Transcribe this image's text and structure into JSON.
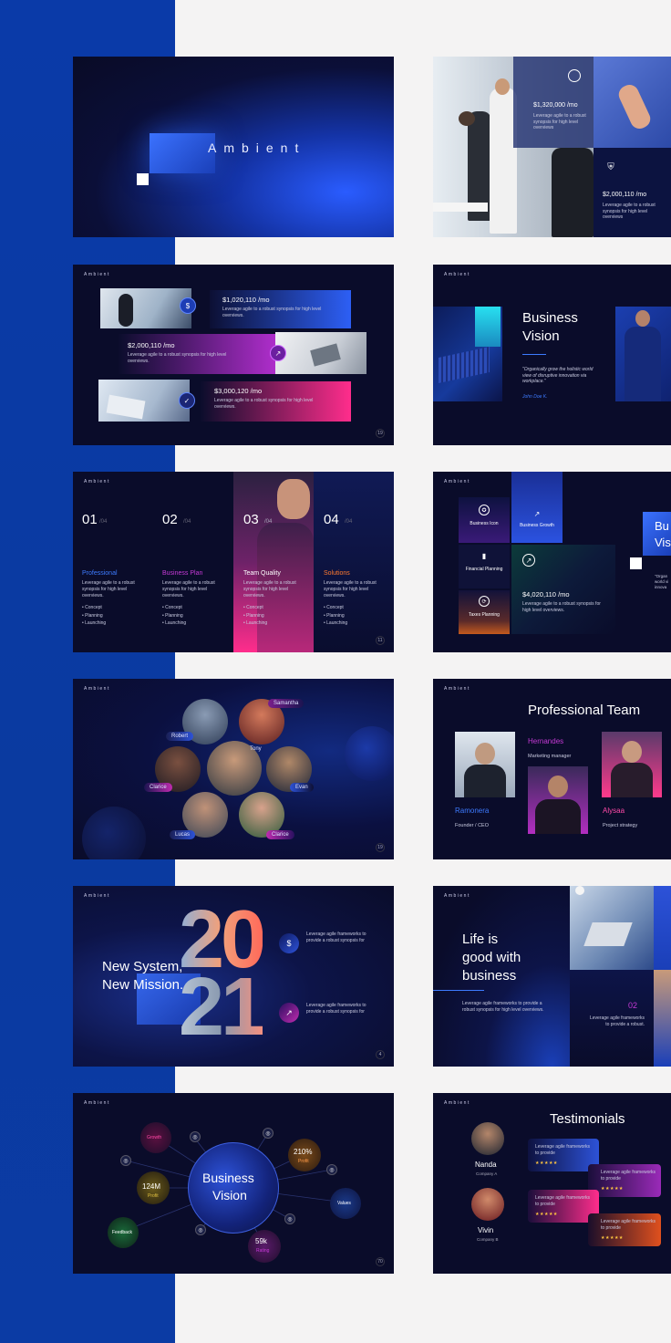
{
  "s1": {
    "title": "Ambient"
  },
  "s2": {
    "stat1": {
      "value": "$1,320,000 /mo",
      "text": "Leverage agile to a robust synopsis for high level overviews"
    },
    "stat2": {
      "value": "$2,000,110 /mo",
      "text": "Leverage agile to a robust synopsis for high level overviews"
    }
  },
  "s3": {
    "brand": "Ambient",
    "items": [
      {
        "value": "$1,020,110 /mo",
        "text": "Leverage agile to a robust synopsis for high level overviews."
      },
      {
        "value": "$2,000,110 /mo",
        "text": "Leverage agile to a robust synopsis for high level overviews."
      },
      {
        "value": "$3,000,120 /mo",
        "text": "Leverage agile to a robust synopsis for high level overviews."
      }
    ],
    "page": "19"
  },
  "s4": {
    "brand": "Ambient",
    "title1": "Business",
    "title2": "Vision",
    "quote": "\"Organically grow the holistic world view of disruptive innovation via workplace.\"",
    "author": "John Doe K."
  },
  "s5": {
    "brand": "Ambient",
    "cols": [
      {
        "num": "01",
        "total": "/04",
        "title": "Professional",
        "text": "Leverage agile to a robust synopsis for high level overviews.",
        "bullets": [
          "Concept",
          "Planning",
          "Launching"
        ],
        "color": "#3d7bff"
      },
      {
        "num": "02",
        "total": "/04",
        "title": "Business Plan",
        "text": "Leverage agile to a robust synopsis for high level overviews.",
        "bullets": [
          "Concept",
          "Planning",
          "Launching"
        ],
        "color": "#c63ad6"
      },
      {
        "num": "03",
        "total": "/04",
        "title": "Team Quality",
        "text": "Leverage agile to a robust synopsis for high level overviews.",
        "bullets": [
          "Concept",
          "Planning",
          "Launching"
        ],
        "color": "#ffffff"
      },
      {
        "num": "04",
        "total": "/04",
        "title": "Solutions",
        "text": "Leverage agile to a robust synopsis for high level overviews.",
        "bullets": [
          "Concept",
          "Planning",
          "Launching"
        ],
        "color": "#ff7a2e"
      }
    ],
    "page": "11"
  },
  "s6": {
    "brand": "Ambient",
    "tiles": [
      {
        "label": "Business Icon",
        "icon": "award-icon"
      },
      {
        "label": "Business Growth",
        "icon": "chart-icon"
      },
      {
        "label": "Financial Planning",
        "icon": "bar-chart-icon"
      },
      {
        "label": "Taxes Planning",
        "icon": "refresh-icon"
      }
    ],
    "stat": {
      "value": "$4,020,110 /mo",
      "text": "Leverage agile to a robust synopsis for high level overviews."
    },
    "side_title1": "Bu",
    "side_title2": "Vis",
    "side_text": "\"Organ world vi innova"
  },
  "s7": {
    "brand": "Ambient",
    "people": [
      "Samantha",
      "Robert",
      "Tony",
      "Clarice",
      "Evan",
      "Lucas",
      "Clarice"
    ],
    "page": "19"
  },
  "s8": {
    "brand": "Ambient",
    "title": "Professional Team",
    "members": [
      {
        "name": "Hernandes",
        "role": "Marketing manager",
        "color": "#c63ad6"
      },
      {
        "name": "Ramonera",
        "role": "Founder / CEO",
        "color": "#3d7bff"
      },
      {
        "name": "Alysaa",
        "role": "Project strategy",
        "color": "#ff4aa8"
      }
    ]
  },
  "s9": {
    "brand": "Ambient",
    "line1": "New System,",
    "line2": "New Mission.",
    "year1": "20",
    "year2": "21",
    "item1": "Leverage agile frameworks to provide a robust synopsis for",
    "item2": "Leverage agile frameworks to provide a robust synopsis for",
    "page": "4"
  },
  "s10": {
    "brand": "Ambient",
    "line1": "Life is",
    "line2": "good with",
    "line3": "business",
    "text": "Leverage agile frameworks to provide a robust synopsis for high level overviews.",
    "num": "02",
    "num_text": "Leverage agile frameworks to provide a robust."
  },
  "s11": {
    "brand": "Ambient",
    "center1": "Business",
    "center2": "Vision",
    "nodes": [
      {
        "label": "Growth"
      },
      {
        "value": "210%",
        "label": "Profit"
      },
      {
        "value": "124M",
        "label": "Profit"
      },
      {
        "label": "Values"
      },
      {
        "label": "Feedback"
      },
      {
        "value": "59k",
        "label": "Rating"
      }
    ],
    "page": "70"
  },
  "s12": {
    "brand": "Ambient",
    "title": "Testimonials",
    "people": [
      {
        "name": "Nanda",
        "company": "Company A"
      },
      {
        "name": "Vivin",
        "company": "Company B"
      }
    ],
    "quote": "Leverage agile frameworks to provide",
    "stars": "★★★★★"
  },
  "colors": {
    "band": "#0a3aa8",
    "slide_bg": "#0b0d2b",
    "accent_blue": "#2d6bff",
    "accent_pink": "#ff2d8c",
    "accent_purple": "#c63ad6",
    "accent_orange": "#ff7a2e"
  }
}
